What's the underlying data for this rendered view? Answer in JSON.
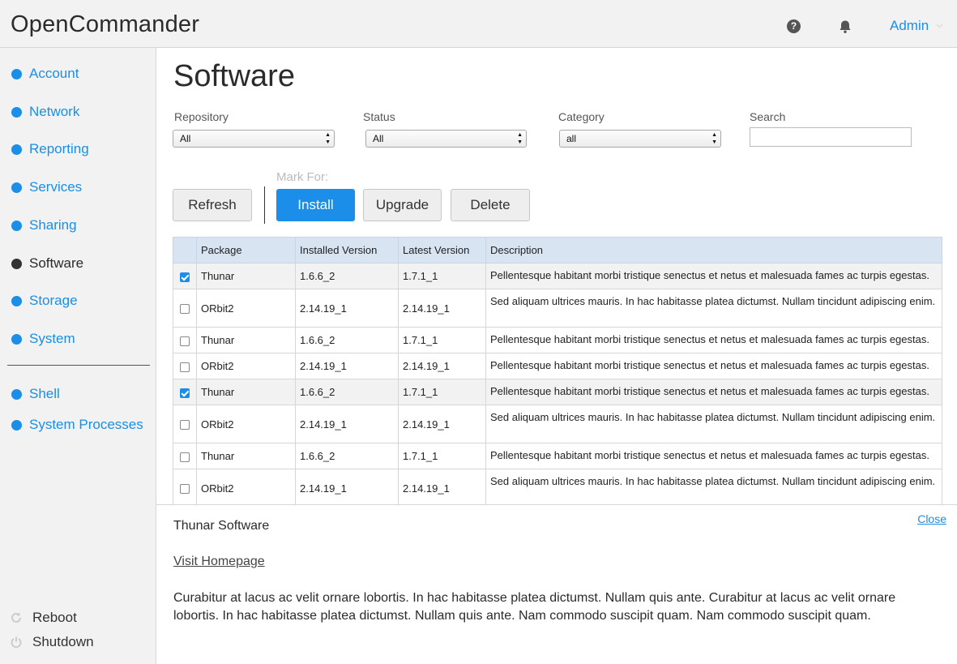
{
  "app": {
    "title": "OpenCommander",
    "help_icon": "question-circle-icon",
    "bell_icon": "bell-icon",
    "user_menu": "Admin"
  },
  "sidebar": {
    "items": [
      {
        "label": "Account",
        "active": false
      },
      {
        "label": "Network",
        "active": false
      },
      {
        "label": "Reporting",
        "active": false
      },
      {
        "label": "Services",
        "active": false
      },
      {
        "label": "Sharing",
        "active": false
      },
      {
        "label": "Software",
        "active": true
      },
      {
        "label": "Storage",
        "active": false
      },
      {
        "label": "System",
        "active": false
      }
    ],
    "extra_items": [
      {
        "label": "Shell"
      },
      {
        "label": "System Processes"
      }
    ],
    "power": {
      "reboot": "Reboot",
      "shutdown": "Shutdown"
    }
  },
  "main": {
    "title": "Software",
    "filters": {
      "repository": {
        "label": "Repository",
        "value": "All"
      },
      "status": {
        "label": "Status",
        "value": "All"
      },
      "category": {
        "label": "Category",
        "value": "all"
      },
      "search": {
        "label": "Search",
        "value": ""
      }
    },
    "mark_for_label": "Mark For:",
    "buttons": {
      "refresh": "Refresh",
      "install": "Install",
      "upgrade": "Upgrade",
      "delete": "Delete"
    },
    "table": {
      "columns": [
        "Package",
        "Installed Version",
        "Latest Version",
        "Description"
      ],
      "rows": [
        {
          "checked": true,
          "package": "Thunar",
          "installed": "1.6.6_2",
          "latest": "1.7.1_1",
          "description": "Pellentesque habitant morbi tristique senectus et netus et malesuada fames ac turpis egestas."
        },
        {
          "checked": false,
          "package": "ORbit2",
          "installed": "2.14.19_1",
          "latest": "2.14.19_1",
          "description": "Sed aliquam ultrices mauris. In hac habitasse platea dictumst. Nullam tincidunt adipiscing enim."
        },
        {
          "checked": false,
          "package": "Thunar",
          "installed": "1.6.6_2",
          "latest": "1.7.1_1",
          "description": "Pellentesque habitant morbi tristique senectus et netus et malesuada fames ac turpis egestas."
        },
        {
          "checked": false,
          "package": "ORbit2",
          "installed": "2.14.19_1",
          "latest": "2.14.19_1",
          "description": "Pellentesque habitant morbi tristique senectus et netus et malesuada fames ac turpis egestas."
        },
        {
          "checked": true,
          "package": "Thunar",
          "installed": "1.6.6_2",
          "latest": "1.7.1_1",
          "description": "Pellentesque habitant morbi tristique senectus et netus et malesuada fames ac turpis egestas."
        },
        {
          "checked": false,
          "package": "ORbit2",
          "installed": "2.14.19_1",
          "latest": "2.14.19_1",
          "description": "Sed aliquam ultrices mauris. In hac habitasse platea dictumst. Nullam tincidunt adipiscing enim."
        },
        {
          "checked": false,
          "package": "Thunar",
          "installed": "1.6.6_2",
          "latest": "1.7.1_1",
          "description": "Pellentesque habitant morbi tristique senectus et netus et malesuada fames ac turpis egestas."
        },
        {
          "checked": false,
          "package": "ORbit2",
          "installed": "2.14.19_1",
          "latest": "2.14.19_1",
          "description": "Sed aliquam ultrices mauris. In hac habitasse platea dictumst. Nullam tincidunt adipiscing enim."
        }
      ]
    }
  },
  "detail": {
    "title": "Thunar Software",
    "close": "Close",
    "homepage_link": "Visit Homepage",
    "body": "Curabitur at lacus ac velit ornare lobortis. In hac habitasse platea dictumst. Nullam quis ante.  Curabitur at lacus ac velit ornare lobortis. In hac habitasse platea dictumst. Nullam quis ante. Nam commodo suscipit quam. Nam commodo suscipit quam."
  },
  "colors": {
    "accent": "#1a8ee8",
    "header_row": "#d8e4f2",
    "chrome_bg": "#f2f2f2"
  }
}
